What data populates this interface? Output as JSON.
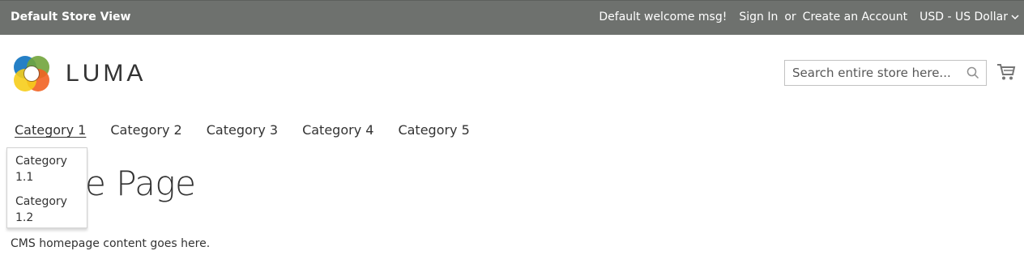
{
  "topbar": {
    "store_view": "Default Store View",
    "welcome": "Default welcome msg!",
    "sign_in": "Sign In",
    "or": "or",
    "create_account": "Create an Account",
    "currency": "USD - US Dollar"
  },
  "logo": {
    "text": "LUMA",
    "colors": [
      "#1979c3",
      "#71a43b",
      "#f26322",
      "#f6cd1b"
    ]
  },
  "search": {
    "placeholder": "Search entire store here..."
  },
  "nav": {
    "items": [
      "Category 1",
      "Category 2",
      "Category 3",
      "Category 4",
      "Category 5"
    ],
    "active_index": 0
  },
  "dropdown": {
    "items": [
      "Category 1.1",
      "Category 1.2"
    ]
  },
  "main": {
    "title_visible": "e Page",
    "cms_text": "CMS homepage content goes here."
  },
  "colors": {
    "topbar_bg": "#6e716e",
    "text": "#333333"
  }
}
